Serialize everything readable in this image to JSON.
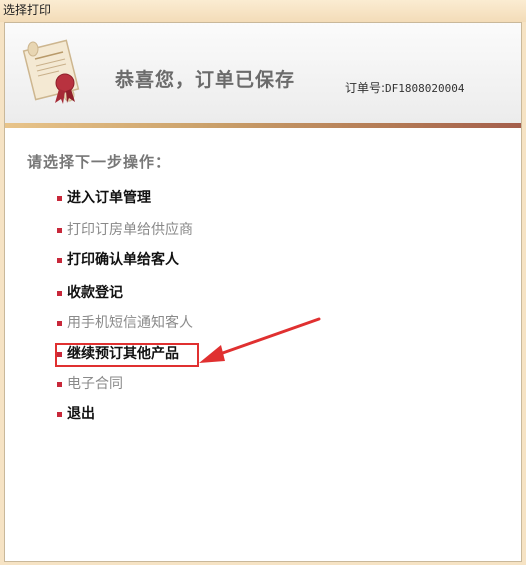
{
  "window": {
    "title": "选择打印"
  },
  "header": {
    "congrats": "恭喜您，订单已保存",
    "order_label": "订单号:",
    "order_number": "DF1808020004",
    "logo_icon": "certificate-icon"
  },
  "main": {
    "prompt": "请选择下一步操作：",
    "items": [
      {
        "label": "进入订单管理",
        "style": "dark"
      },
      {
        "label": "打印订房单给供应商",
        "style": "gray"
      },
      {
        "label": "打印确认单给客人",
        "style": "dark"
      },
      {
        "label": "收款登记",
        "style": "dark"
      },
      {
        "label": "用手机短信通知客人",
        "style": "gray"
      },
      {
        "label": "继续预订其他产品",
        "style": "dark"
      },
      {
        "label": "电子合同",
        "style": "gray"
      },
      {
        "label": "退出",
        "style": "dark"
      }
    ]
  },
  "annotation": {
    "color": "#e03030",
    "target_item": "继续预订其他产品"
  }
}
